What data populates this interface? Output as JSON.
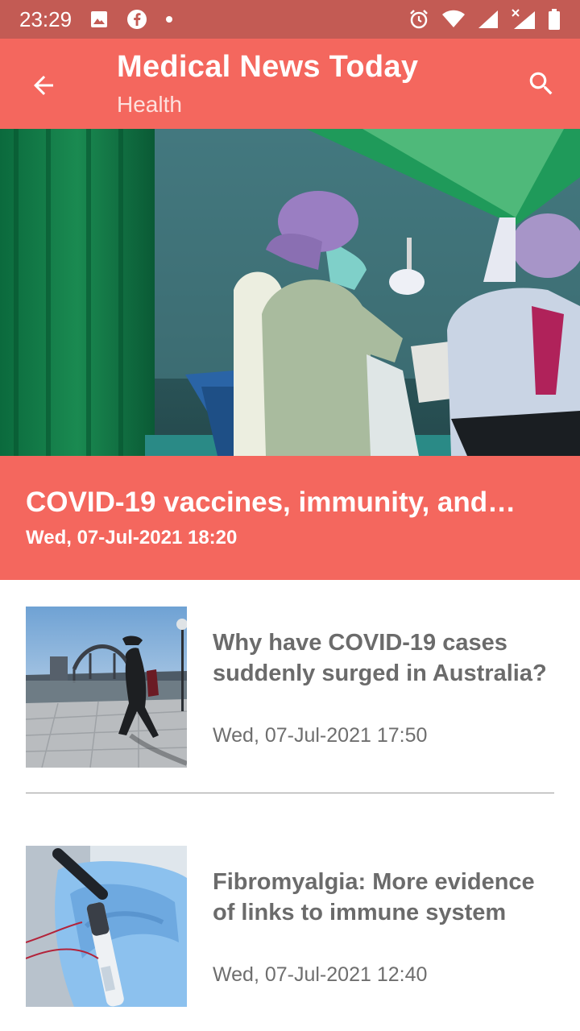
{
  "status_bar": {
    "time": "23:29",
    "left_icons": [
      "image-icon",
      "facebook-icon",
      "dot-icon"
    ],
    "right_icons": [
      "alarm-icon",
      "wifi-icon",
      "signal-icon",
      "signal-x-icon",
      "battery-icon"
    ]
  },
  "app_bar": {
    "title": "Medical News Today",
    "subtitle": "Health",
    "back_icon": "arrow-back-icon",
    "search_icon": "search-icon"
  },
  "featured": {
    "image": "vaccine-preparation-photo",
    "title": "COVID-19 vaccines, immunity, and…",
    "date": "Wed, 07-Jul-2021 18:20"
  },
  "articles": [
    {
      "image": "sydney-harbour-walker-photo",
      "title": "Why have COVID-19 cases suddenly surged in Australia?",
      "date": "Wed, 07-Jul-2021 17:50"
    },
    {
      "image": "gloved-hand-blood-tube-photo",
      "title": "Fibromyalgia: More evidence of links to immune system",
      "date": "Wed, 07-Jul-2021 12:40"
    }
  ],
  "colors": {
    "status_bar": "#c35b54",
    "primary": "#f4675e",
    "text_gray": "#6b6b6b"
  }
}
